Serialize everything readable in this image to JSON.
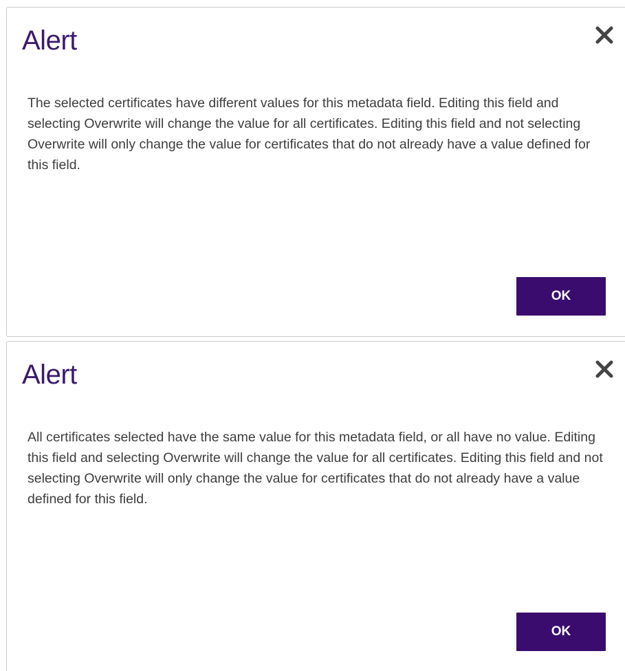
{
  "dialogs": [
    {
      "title": "Alert",
      "message": "The selected certificates have different values for this metadata field. Editing this field and selecting Overwrite will change the value for all certificates. Editing this field and not selecting Overwrite will only change the value for certificates that do not already have a value defined for this field.",
      "ok_label": "OK",
      "close_icon": "close-icon"
    },
    {
      "title": "Alert",
      "message": "All certificates selected have the same value for this metadata field, or all have no value. Editing this field and selecting Overwrite will change the value for all certificates. Editing this field and not selecting Overwrite will only change the value for certificates that do not already have a value defined for this field.",
      "ok_label": "OK",
      "close_icon": "close-icon"
    }
  ],
  "colors": {
    "title": "#3b1a6b",
    "button_bg": "#3a0c6e",
    "button_text": "#ffffff",
    "body_text": "#3d3d3d",
    "close_icon": "#444444",
    "border": "#c9c9c9"
  }
}
